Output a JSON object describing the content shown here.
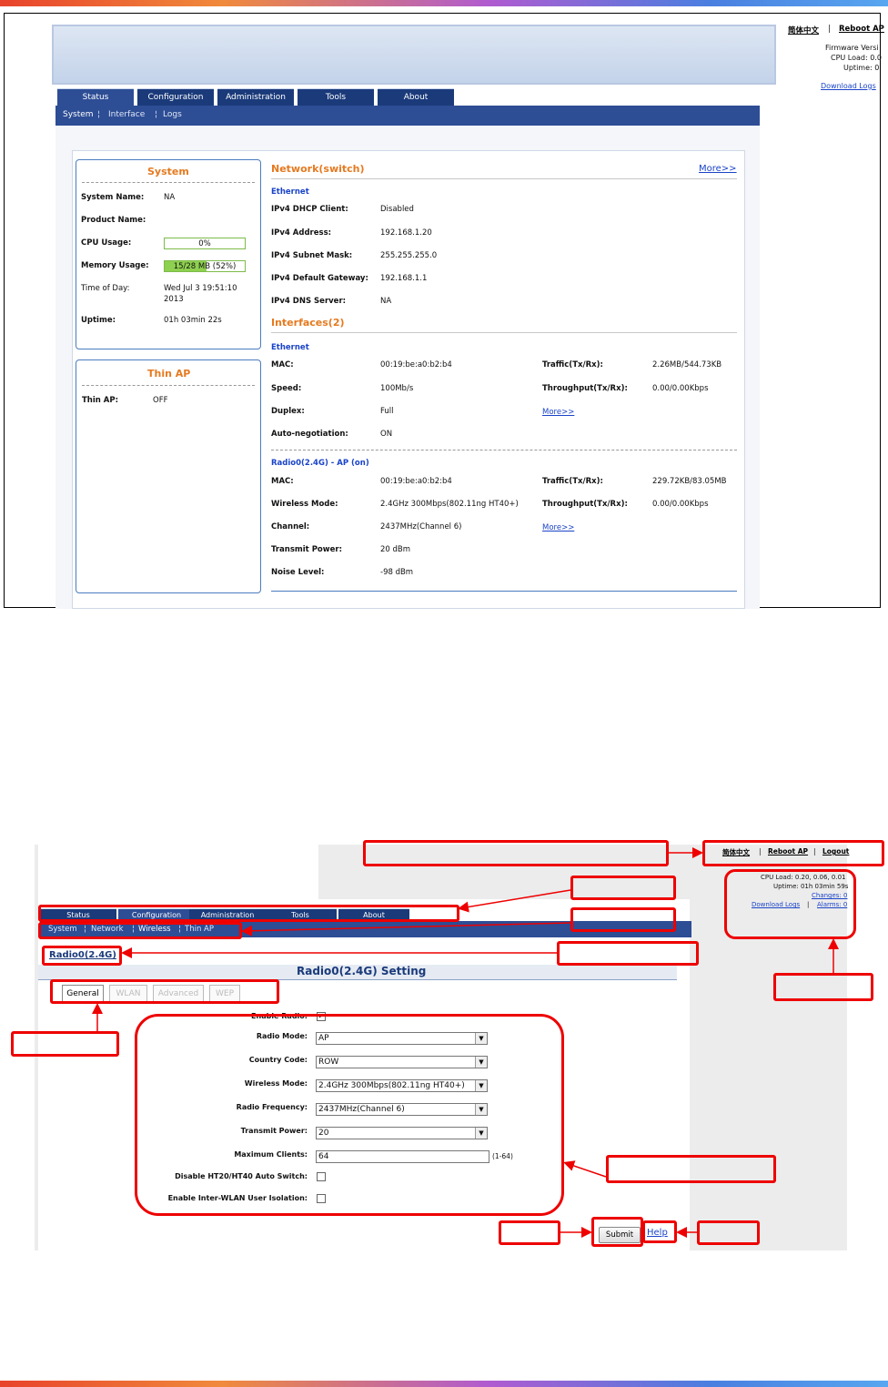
{
  "top": {
    "lang_link": "简体中文",
    "reboot_link": "Reboot AP",
    "firmware_text": "Firmware Versi",
    "cpu_load_text": "CPU Load: 0.0",
    "uptime_text": "Uptime: 0",
    "download_logs": "Download Logs",
    "tabs": [
      {
        "label": "Status"
      },
      {
        "label": "Configuration"
      },
      {
        "label": "Administration"
      },
      {
        "label": "Tools"
      },
      {
        "label": "About"
      }
    ],
    "subnav": [
      "System",
      "Interface",
      "Logs"
    ],
    "system_panel": {
      "title": "System",
      "rows": [
        {
          "label": "System Name:",
          "value": "NA"
        },
        {
          "label": "Product Name:",
          "value": ""
        },
        {
          "label": "CPU Usage:",
          "value": "0%"
        },
        {
          "label": "Memory Usage:",
          "value": "15/28 MB (52%)"
        },
        {
          "label": "Time of Day:",
          "value": "Wed Jul 3 19:51:10",
          "value2": "2013"
        },
        {
          "label": "Uptime:",
          "value": "01h 03min 22s"
        }
      ],
      "cpu_fraction": 0.0,
      "mem_fraction": 0.52
    },
    "thin_panel": {
      "title": "Thin AP",
      "label": "Thin AP:",
      "value": "OFF"
    },
    "network": {
      "title": "Network(switch)",
      "more": "More>>",
      "section": "Ethernet",
      "rows": [
        {
          "label": "IPv4 DHCP Client:",
          "value": "Disabled"
        },
        {
          "label": "IPv4 Address:",
          "value": "192.168.1.20"
        },
        {
          "label": "IPv4 Subnet Mask:",
          "value": "255.255.255.0"
        },
        {
          "label": "IPv4 Default Gateway:",
          "value": "192.168.1.1"
        },
        {
          "label": "IPv4 DNS Server:",
          "value": "NA"
        }
      ]
    },
    "interfaces": {
      "title": "Interfaces(2)",
      "eth_section": "Ethernet",
      "eth_rows": [
        {
          "label": "MAC:",
          "value": "00:19:be:a0:b2:b4",
          "label2": "Traffic(Tx/Rx):",
          "value2": "2.26MB/544.73KB"
        },
        {
          "label": "Speed:",
          "value": "100Mb/s",
          "label2": "Throughput(Tx/Rx):",
          "value2": "0.00/0.00Kbps"
        },
        {
          "label": "Duplex:",
          "value": "Full",
          "more": "More>>"
        },
        {
          "label": "Auto-negotiation:",
          "value": "ON"
        }
      ],
      "radio_section": "Radio0(2.4G)  -  AP (on)",
      "radio_rows": [
        {
          "label": "MAC:",
          "value": "00:19:be:a0:b2:b4",
          "label2": "Traffic(Tx/Rx):",
          "value2": "229.72KB/83.05MB"
        },
        {
          "label": "Wireless Mode:",
          "value": "2.4GHz 300Mbps(802.11ng HT40+)",
          "label2": "Throughput(Tx/Rx):",
          "value2": "0.00/0.00Kbps"
        },
        {
          "label": "Channel:",
          "value": "2437MHz(Channel 6)",
          "more": "More>>"
        },
        {
          "label": "Transmit Power:",
          "value": "20 dBm"
        },
        {
          "label": "Noise Level:",
          "value": "-98 dBm"
        }
      ]
    }
  },
  "bottom": {
    "lang_link": "简体中文",
    "reboot_link": "Reboot AP",
    "logout_link": "Logout",
    "cpu_load": "CPU Load: 0.20, 0.06, 0.01",
    "uptime": "Uptime: 01h 03min 59s",
    "changes": "Changes: 0",
    "download_logs": "Download Logs",
    "alarms": "Alarms: 0",
    "tabs": [
      {
        "label": "Status"
      },
      {
        "label": "Configuration"
      },
      {
        "label": "Administration"
      },
      {
        "label": "Tools"
      },
      {
        "label": "About"
      }
    ],
    "subnav": [
      "System",
      "Network",
      "Wireless",
      "Thin AP"
    ],
    "breadcrumb": "Radio0(2.4G)",
    "setting_title": "Radio0(2.4G) Setting",
    "form_tabs": [
      "General",
      "WLAN",
      "Advanced",
      "WEP"
    ],
    "form": {
      "enable_radio_label": "Enable Radio:",
      "enable_radio_mark": "✓",
      "radio_mode_label": "Radio Mode:",
      "radio_mode_value": "AP",
      "country_label": "Country Code:",
      "country_value": "ROW",
      "wireless_mode_label": "Wireless Mode:",
      "wireless_mode_value": "2.4GHz 300Mbps(802.11ng HT40+)",
      "freq_label": "Radio Frequency:",
      "freq_value": "2437MHz(Channel 6)",
      "tx_power_label": "Transmit Power:",
      "tx_power_value": "20",
      "max_clients_label": "Maximum Clients:",
      "max_clients_value": "64",
      "max_clients_range": "(1-64)",
      "ht_label": "Disable HT20/HT40 Auto Switch:",
      "isolation_label": "Enable Inter-WLAN User Isolation:"
    },
    "submit": "Submit",
    "help": "Help"
  },
  "colors": {
    "nav_dark": "#1a3a7a",
    "nav_blue": "#2d4d95",
    "accent_orange": "#e57a20",
    "link_blue": "#1a44c8",
    "annotation_red": "#e00000"
  }
}
